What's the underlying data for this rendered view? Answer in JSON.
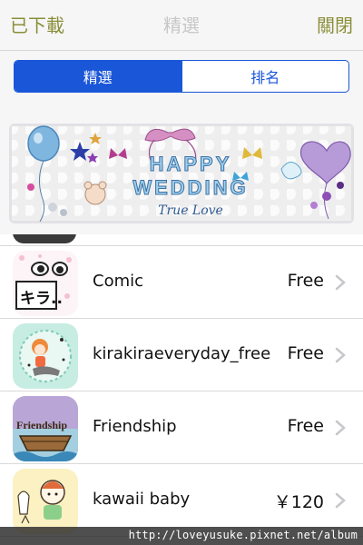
{
  "navbar": {
    "left_label": "已下載",
    "title": "精選",
    "right_label": "關閉"
  },
  "segmented": {
    "options": [
      "精選",
      "排名"
    ],
    "selected": "精選"
  },
  "banner": {
    "line1": "HAPPY",
    "line2": "WEDDING",
    "line3": "True Love"
  },
  "apps": [
    {
      "name": "Comic",
      "price": "Free",
      "icon": "comic-icon",
      "icon_text": "キラ.."
    },
    {
      "name": "kirakiraeveryday_free",
      "price": "Free",
      "icon": "kirakira-icon"
    },
    {
      "name": "Friendship",
      "price": "Free",
      "icon": "friendship-icon",
      "icon_text": "Friendship"
    },
    {
      "name": "kawaii baby",
      "price": "￥120",
      "icon": "kawaii-baby-icon"
    }
  ],
  "watermark": "http://loveyusuke.pixnet.net/album",
  "colors": {
    "accent_blue": "#1a56d8",
    "nav_olive": "#8a8f3a",
    "title_gray": "#c7c7c7"
  }
}
